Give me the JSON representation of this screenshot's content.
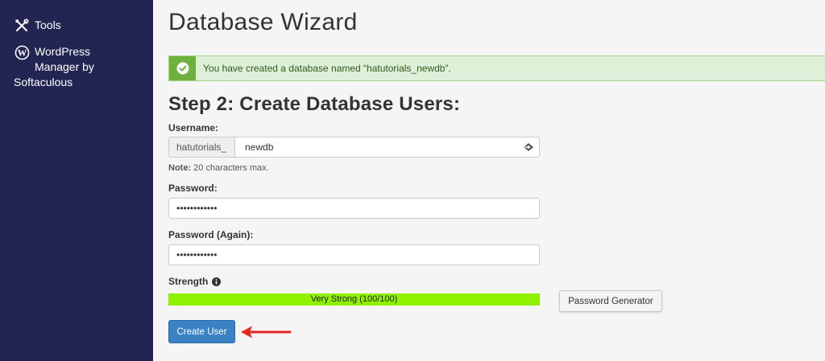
{
  "sidebar": {
    "items": [
      {
        "label": "Tools",
        "icon": "tools-icon"
      },
      {
        "label_line1": "WordPress",
        "label_line2": "Manager by",
        "label_line3": "Softaculous",
        "icon": "wordpress-icon"
      }
    ]
  },
  "main": {
    "page_title": "Database Wizard",
    "alert": {
      "text": "You have created a database named “hatutorials_newdb”.",
      "icon": "check-circle-icon"
    },
    "step_title": "Step 2: Create Database Users:",
    "username": {
      "label": "Username:",
      "prefix": "hatutorials_",
      "value": "newdb",
      "note_bold": "Note:",
      "note_text": " 20 characters max."
    },
    "password": {
      "label": "Password:",
      "value": "••••••••••••"
    },
    "password_again": {
      "label": "Password (Again):",
      "value": "••••••••••••"
    },
    "strength": {
      "label": "Strength",
      "text": "Very Strong (100/100)",
      "percent": 100,
      "color": "#8ff000"
    },
    "password_generator_label": "Password Generator",
    "create_user_label": "Create User"
  },
  "colors": {
    "sidebar_bg": "#222552",
    "alert_bg": "#dff0d8",
    "alert_icon_bg": "#6fb03f",
    "primary_button": "#3b82c4",
    "arrow": "#e8261f"
  }
}
